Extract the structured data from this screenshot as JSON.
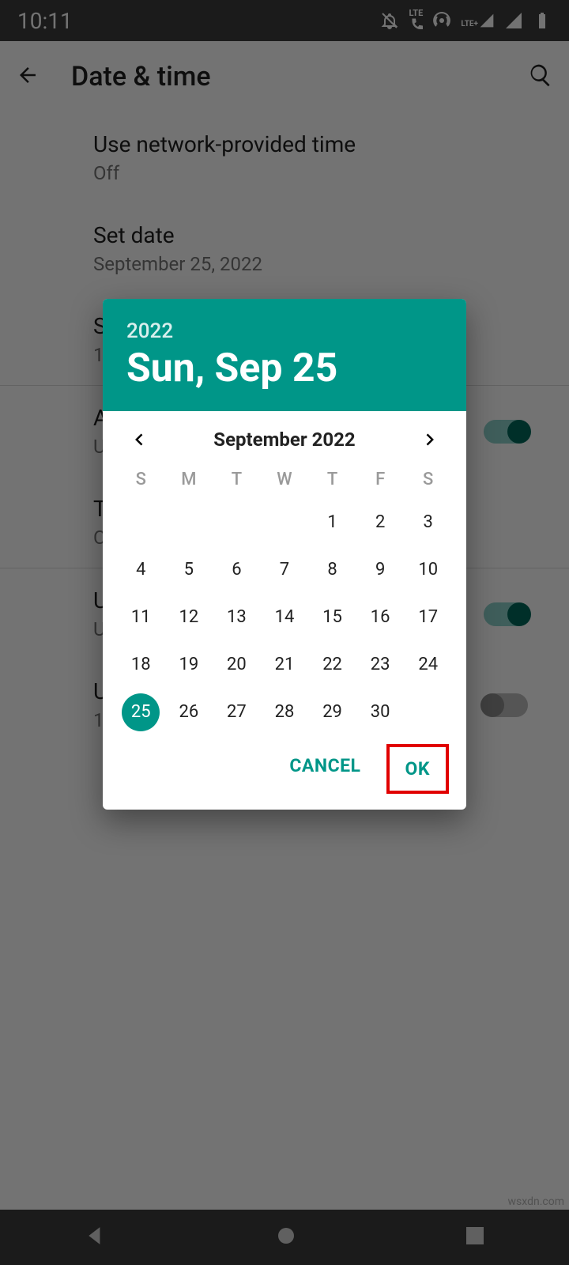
{
  "statusbar": {
    "time": "10:11"
  },
  "appbar": {
    "title": "Date & time"
  },
  "settings": {
    "network_time": {
      "title": "Use network-provided time",
      "value": "Off"
    },
    "set_date": {
      "title": "Set date",
      "value": "September 25, 2022"
    },
    "set_time": {
      "title": "S",
      "value": "1"
    },
    "auto_tz": {
      "title": "A",
      "value": "U"
    },
    "tz": {
      "title": "T",
      "value": "C"
    },
    "locale": {
      "title": "U",
      "value": "U"
    },
    "twentyfour": {
      "title": "U",
      "value": "1"
    }
  },
  "dialog": {
    "year": "2022",
    "date_display": "Sun, Sep 25",
    "month_label": "September 2022",
    "weekdays": [
      "S",
      "M",
      "T",
      "W",
      "T",
      "F",
      "S"
    ],
    "lead_blanks": 4,
    "days_in_month": 30,
    "selected_day": 25,
    "cancel": "CANCEL",
    "ok": "OK"
  },
  "watermark": "wsxdn.com"
}
